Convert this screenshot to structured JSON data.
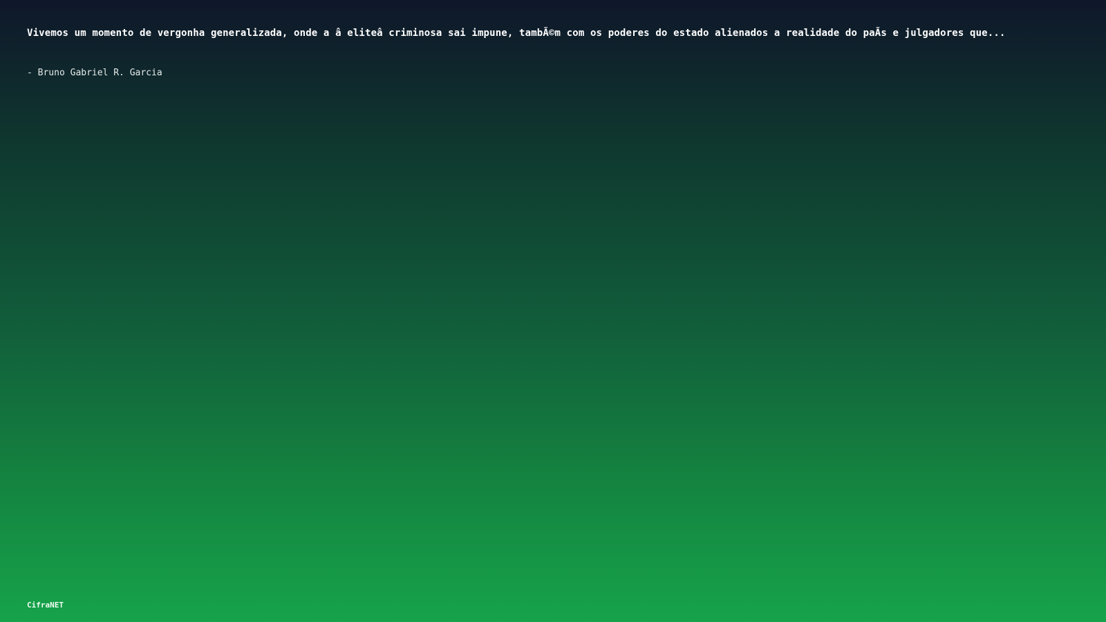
{
  "quote": {
    "text": "Vivemos um momento de vergonha generalizada, onde a â  eliteâ   criminosa sai impune, tambÃ©m com os poderes do estado alienados a realidade do paÃ­s e julgadores que...",
    "author": "- Bruno Gabriel R. Garcia"
  },
  "brand": {
    "name": "CifraNET"
  },
  "colors": {
    "background_top": "#0f172a",
    "background_bottom": "#16a34a",
    "text": "#ffffff"
  }
}
